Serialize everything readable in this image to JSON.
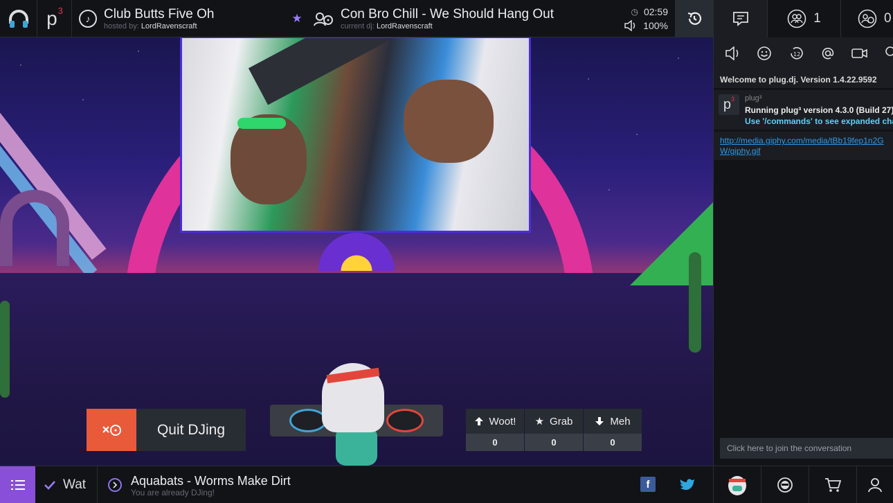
{
  "room": {
    "name": "Club Butts Five Oh",
    "hosted_label": "hosted by:",
    "host": "LordRavenscraft"
  },
  "now_playing": {
    "title": "Con Bro Chill - We Should Hang Out",
    "dj_label": "current dj:",
    "dj": "LordRavenscraft"
  },
  "time_remaining": "02:59",
  "volume": "100%",
  "brand": {
    "p": "p",
    "sup": "3"
  },
  "quit_dj": {
    "label": "Quit DJing"
  },
  "votes": [
    {
      "label": "Woot!",
      "count": "0"
    },
    {
      "label": "Grab",
      "count": "0"
    },
    {
      "label": "Meh",
      "count": "0"
    }
  ],
  "bottom": {
    "playlist_name": "Wat",
    "next_song": "Aquabats - Worms Make Dirt",
    "status": "You are already DJing!",
    "facebook": "f"
  },
  "panel": {
    "users_count": "1",
    "waitlist_count": "0"
  },
  "chat": {
    "welcome": "Welcome to plug.dj. Version 1.4.22.9592",
    "plug3": {
      "name": "plug³",
      "line1": "Running plug³ version 4.3.0 (Build 27)",
      "line2": "Use '/commands' to see expanded chat commands"
    },
    "link": "http://media.giphy.com/media/tBb19fep1n2GW/giphy.gif",
    "placeholder": "Click here to join the conversation"
  },
  "colors": {
    "accent": "#8a4fd8",
    "quit": "#e95a3a",
    "link": "#2d9bea",
    "p3_info": "#5fd0f7"
  }
}
